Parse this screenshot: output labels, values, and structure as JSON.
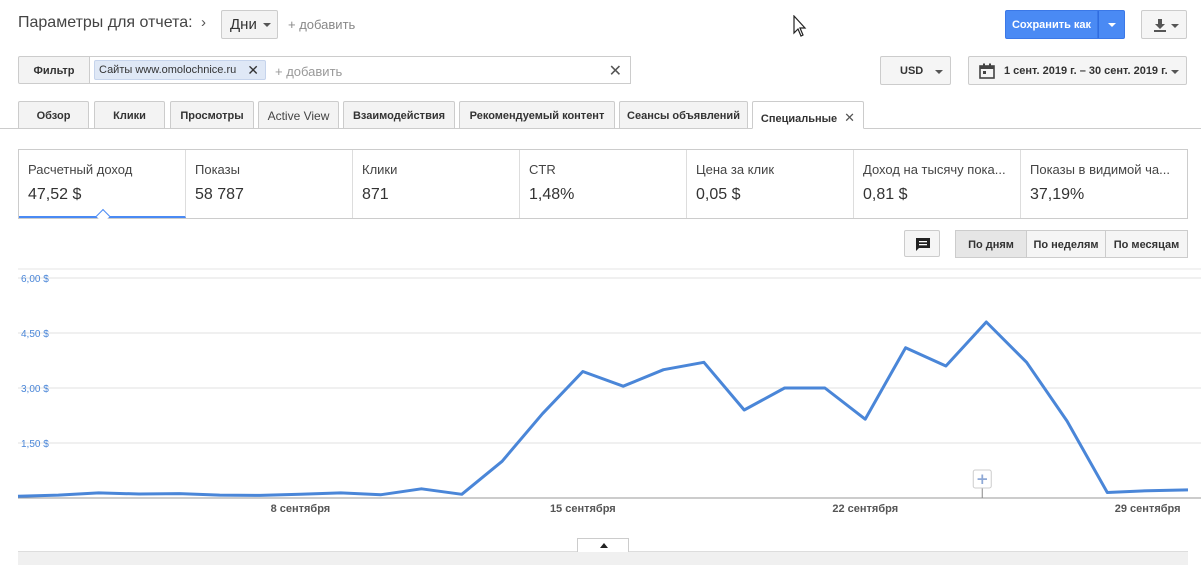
{
  "header": {
    "title": "Параметры для отчета:",
    "dimension": "Дни",
    "add_label": "+ добавить",
    "save_label": "Сохранить как"
  },
  "filter": {
    "label": "Фильтр",
    "chip_prefix": "Сайты",
    "chip_value": "www.omolochnice.ru",
    "add_label": "+ добавить"
  },
  "currency": "USD",
  "date_range": "1 сент. 2019 г. – 30 сент. 2019 г.",
  "tabs": [
    {
      "label": "Обзор"
    },
    {
      "label": "Клики"
    },
    {
      "label": "Просмотры"
    },
    {
      "label": "Active View"
    },
    {
      "label": "Взаимодействия"
    },
    {
      "label": "Рекомендуемый контент"
    },
    {
      "label": "Сеансы объявлений"
    },
    {
      "label": "Специальные"
    }
  ],
  "metrics": [
    {
      "name": "Расчетный доход",
      "value": "47,52 $"
    },
    {
      "name": "Показы",
      "value": "58 787"
    },
    {
      "name": "Клики",
      "value": "871"
    },
    {
      "name": "CTR",
      "value": "1,48%"
    },
    {
      "name": "Цена за клик",
      "value": "0,05 $"
    },
    {
      "name": "Доход на тысячу пока...",
      "value": "0,81 $"
    },
    {
      "name": "Показы в видимой ча...",
      "value": "37,19%"
    }
  ],
  "granularity": [
    {
      "label": "По дням"
    },
    {
      "label": "По неделям"
    },
    {
      "label": "По месяцам"
    }
  ],
  "colors": {
    "accent": "#4a8af4",
    "line": "#4a86d8"
  },
  "chart_data": {
    "type": "line",
    "ylim": [
      0,
      6
    ],
    "y_ticks": [
      "6,00 $",
      "4,50 $",
      "3,00 $",
      "1,50 $"
    ],
    "y_tick_values": [
      6,
      4.5,
      3,
      1.5
    ],
    "x_tick_labels": [
      "8 сентября",
      "15 сентября",
      "22 сентября",
      "29 сентября"
    ],
    "x_tick_days": [
      8,
      15,
      22,
      29
    ],
    "x": [
      1,
      2,
      3,
      4,
      5,
      6,
      7,
      8,
      9,
      10,
      11,
      12,
      13,
      14,
      15,
      16,
      17,
      18,
      19,
      20,
      21,
      22,
      23,
      24,
      25,
      26,
      27,
      28,
      29,
      30
    ],
    "values": [
      0.05,
      0.08,
      0.14,
      0.11,
      0.12,
      0.08,
      0.07,
      0.1,
      0.14,
      0.09,
      0.25,
      0.1,
      1.0,
      2.3,
      3.45,
      3.05,
      3.5,
      3.7,
      2.4,
      3.0,
      3.0,
      2.15,
      4.1,
      3.6,
      4.8,
      3.7,
      2.1,
      0.15,
      0.2,
      0.22
    ],
    "grid": true
  }
}
